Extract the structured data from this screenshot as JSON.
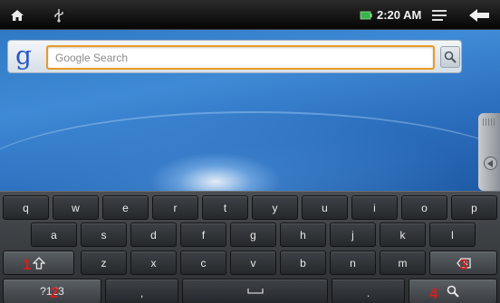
{
  "status_bar": {
    "icons": [
      "home-icon",
      "usb-icon",
      "battery-icon",
      "menu-icon",
      "back-arrow-icon"
    ],
    "time": "2:20 AM",
    "colors": {
      "battery": "#38b44a"
    }
  },
  "search_widget": {
    "logo": "g",
    "placeholder": "Google Search",
    "button_icon": "magnifier-icon"
  },
  "keyboard": {
    "row1": [
      "q",
      "w",
      "e",
      "r",
      "t",
      "y",
      "u",
      "i",
      "o",
      "p"
    ],
    "row2": [
      "a",
      "s",
      "d",
      "f",
      "g",
      "h",
      "j",
      "k",
      "l"
    ],
    "row3": [
      "z",
      "x",
      "c",
      "v",
      "b",
      "n",
      "m"
    ],
    "row4": {
      "symbols_label": "?123",
      "comma_label": ",",
      "period_label": "."
    },
    "special_icons": [
      "shift-icon",
      "backspace-icon",
      "space-bar-icon",
      "search-icon"
    ],
    "annotations": [
      "1",
      "2",
      "3",
      "4"
    ]
  }
}
